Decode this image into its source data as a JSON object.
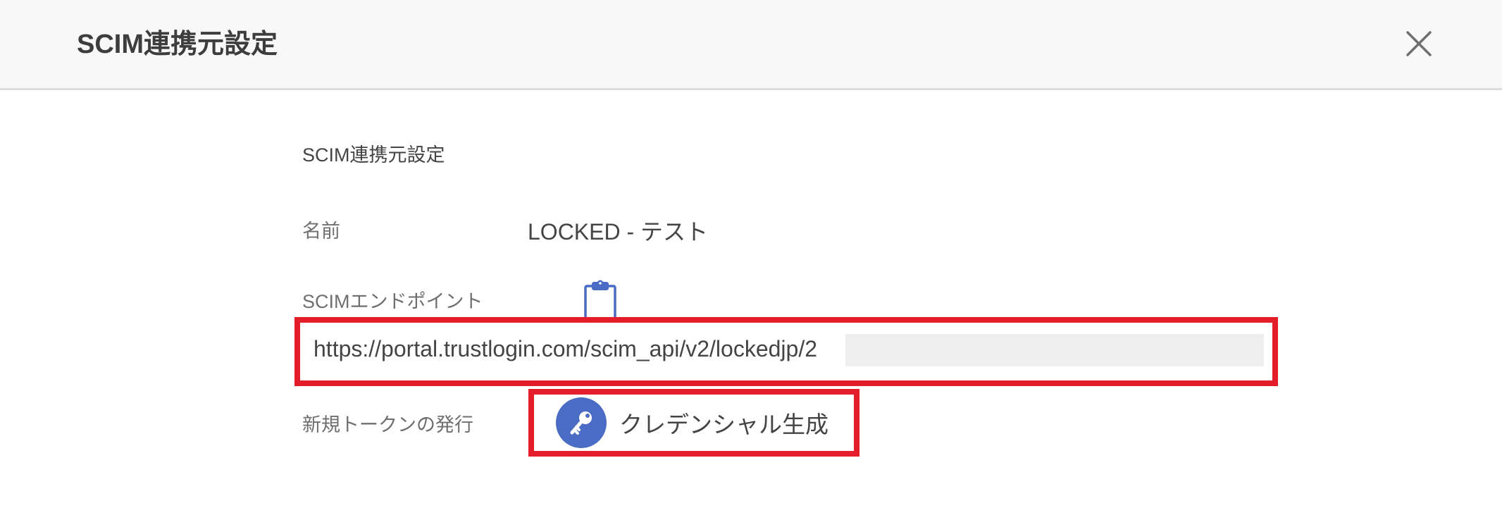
{
  "modal": {
    "title": "SCIM連携元設定"
  },
  "section": {
    "title": "SCIM連携元設定"
  },
  "fields": {
    "name_label": "名前",
    "name_value": "LOCKED - テスト",
    "endpoint_label": "SCIMエンドポイント",
    "endpoint_value": "https://portal.trustlogin.com/scim_api/v2/lockedjp/2",
    "token_label": "新規トークンの発行",
    "credential_button_label": "クレデンシャル生成"
  },
  "icons": {
    "close": "close-icon",
    "copy": "clipboard-icon",
    "key": "key-icon"
  },
  "colors": {
    "header_bg": "#f8f8f8",
    "accent_blue": "#4a6cc4",
    "highlight_red": "#e41d2a"
  }
}
